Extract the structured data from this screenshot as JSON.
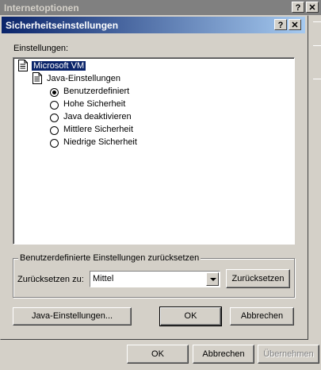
{
  "outer": {
    "title": "Internetoptionen",
    "help_label": "?",
    "close_label": "✕",
    "buttons": {
      "ok": "OK",
      "cancel": "Abbrechen",
      "apply": "Übernehmen"
    }
  },
  "dialog": {
    "title": "Sicherheitseinstellungen",
    "help_label": "?",
    "close_label": "✕",
    "settings_label": "Einstellungen:",
    "tree": {
      "root": "Microsoft VM",
      "child": "Java-Einstellungen",
      "options": [
        {
          "label": "Benutzerdefiniert",
          "selected": true
        },
        {
          "label": "Hohe Sicherheit",
          "selected": false
        },
        {
          "label": "Java deaktivieren",
          "selected": false
        },
        {
          "label": "Mittlere Sicherheit",
          "selected": false
        },
        {
          "label": "Niedrige Sicherheit",
          "selected": false
        }
      ]
    },
    "reset_group": {
      "legend": "Benutzerdefinierte Einstellungen zurücksetzen",
      "reset_to_label": "Zurücksetzen zu:",
      "reset_value": "Mittel",
      "reset_button": "Zurücksetzen"
    },
    "buttons": {
      "java_settings": "Java-Einstellungen...",
      "ok": "OK",
      "cancel": "Abbrechen"
    }
  },
  "colors": {
    "titlebar_active_start": "#0a246a",
    "titlebar_active_end": "#a6caf0",
    "titlebar_inactive": "#808080",
    "face": "#d4d0c8",
    "selection": "#0a246a"
  }
}
